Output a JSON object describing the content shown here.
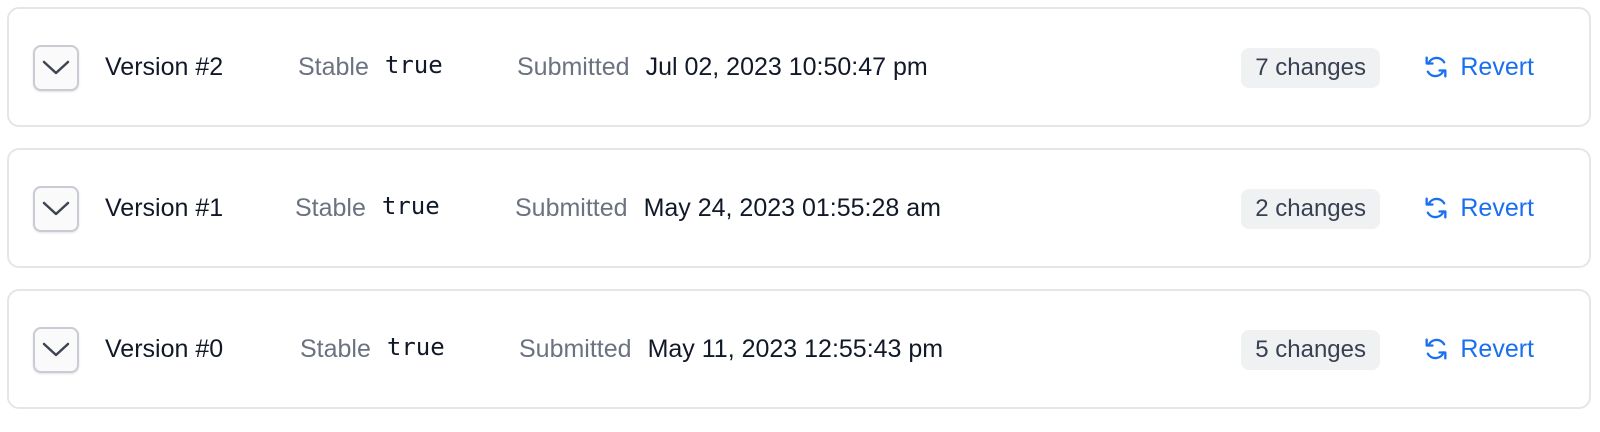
{
  "accent_color": "#1a6ff0",
  "versions": [
    {
      "title": "Version #2",
      "stable_label": "Stable",
      "stable_value": "true",
      "submitted_label": "Submitted",
      "submitted_date": "Jul 02, 2023 10:50:47 pm",
      "changes": "7 changes",
      "action_label": "Revert",
      "toggle_icon": "chevron-down-icon",
      "action_icon": "refresh-icon"
    },
    {
      "title": "Version #1",
      "stable_label": "Stable",
      "stable_value": "true",
      "submitted_label": "Submitted",
      "submitted_date": "May 24, 2023 01:55:28 am",
      "changes": "2 changes",
      "action_label": "Revert",
      "toggle_icon": "chevron-down-icon",
      "action_icon": "refresh-icon"
    },
    {
      "title": "Version #0",
      "stable_label": "Stable",
      "stable_value": "true",
      "submitted_label": "Submitted",
      "submitted_date": "May 11, 2023 12:55:43 pm",
      "changes": "5 changes",
      "action_label": "Revert",
      "toggle_icon": "chevron-down-icon",
      "action_icon": "refresh-icon"
    }
  ]
}
